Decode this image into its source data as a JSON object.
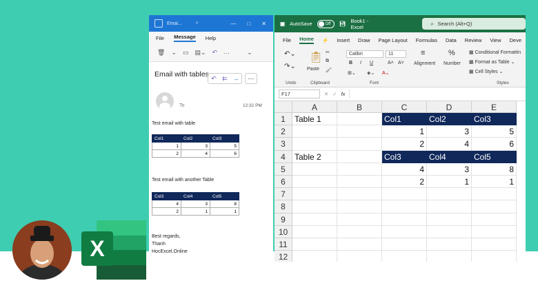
{
  "outlook": {
    "window_title": "Emai...",
    "menu": [
      "File",
      "Message",
      "Help"
    ],
    "subject": "Email with tables",
    "to_label": "To",
    "time": "12:32 PM",
    "line1": "Test email with table",
    "table1": {
      "headers": [
        "Col1",
        "Col2",
        "Col3"
      ],
      "rows": [
        [
          "1",
          "3",
          "5"
        ],
        [
          "2",
          "4",
          "6"
        ]
      ]
    },
    "line2": "Test email with another Table",
    "table2": {
      "headers": [
        "Col3",
        "Col4",
        "Col5"
      ],
      "rows": [
        [
          "4",
          "3",
          "8"
        ],
        [
          "2",
          "1",
          "1"
        ]
      ]
    },
    "sign1": "Best regards,",
    "sign2": "Thanh",
    "sign3": "HocExcel.Online"
  },
  "excel": {
    "autosave": "AutoSave",
    "toggle": "Off",
    "file_title": "Book1 - Excel",
    "search": "Search (Alt+Q)",
    "menu": [
      "File",
      "Home",
      "Insert",
      "Draw",
      "Page Layout",
      "Formulas",
      "Data",
      "Review",
      "View",
      "Deve"
    ],
    "font_name": "Calibri",
    "font_size": "11",
    "paste": "Paste",
    "alignment": "Alignment",
    "number": "Number",
    "cond_format": "Conditional Formattin",
    "format_table": "Format as Table",
    "cell_styles": "Cell Styles",
    "undo_lbl": "Undo",
    "clipboard_lbl": "Clipboard",
    "font_lbl": "Font",
    "styles_lbl": "Styles",
    "namebox": "F17",
    "fx": "fx",
    "columns": [
      "A",
      "B",
      "C",
      "D",
      "E"
    ],
    "rows": [
      "1",
      "2",
      "3",
      "4",
      "5",
      "6",
      "7",
      "8",
      "9",
      "10",
      "11",
      "12"
    ],
    "cells": {
      "A1": "Table 1",
      "C1": "Col1",
      "D1": "Col2",
      "E1": "Col3",
      "C2": "1",
      "D2": "3",
      "E2": "5",
      "C3": "2",
      "D3": "4",
      "E3": "6",
      "A4": "Table 2",
      "C4": "Col3",
      "D4": "Col4",
      "E4": "Col5",
      "C5": "4",
      "D5": "3",
      "E5": "8",
      "C6": "2",
      "D6": "1",
      "E6": "1"
    }
  },
  "colors": {
    "teal": "#3fcdb1",
    "outlook_blue": "#1e76d4",
    "excel_green": "#1b7043",
    "table_header": "#10285a"
  }
}
